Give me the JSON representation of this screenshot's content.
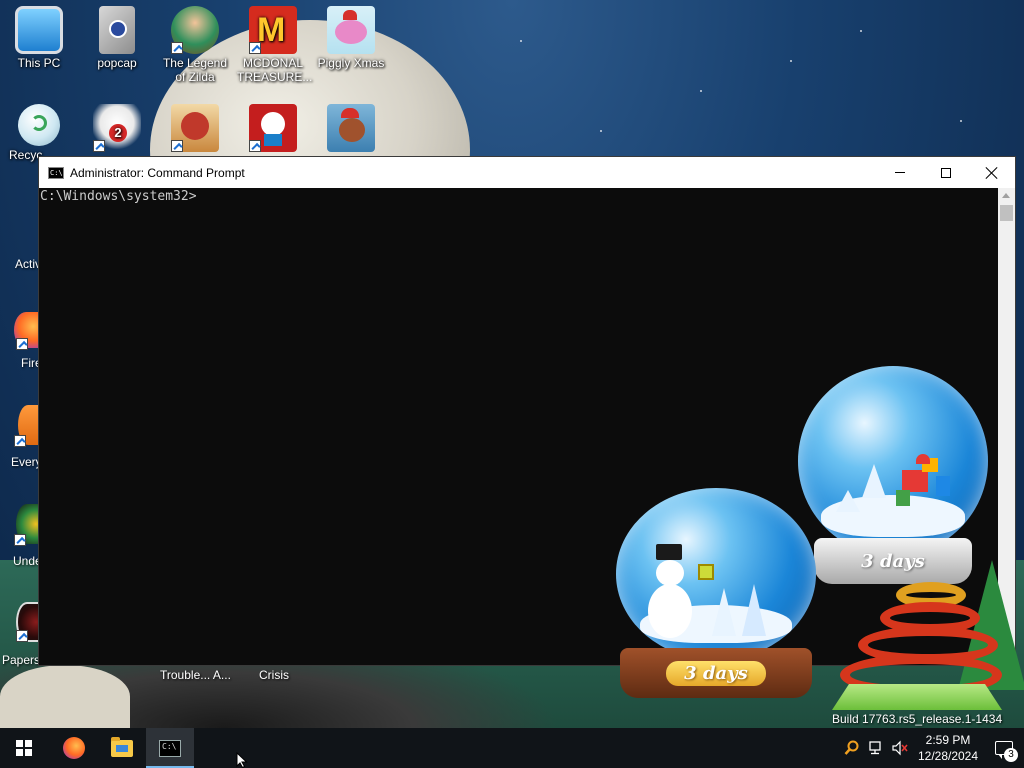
{
  "desktop": {
    "icons": [
      {
        "label": "This PC"
      },
      {
        "label": "popcap"
      },
      {
        "label": "The Legend of Zilda"
      },
      {
        "label": "MCDONAL TREASURE..."
      },
      {
        "label": "Piggly Xmas"
      },
      {
        "label": "Recyc"
      },
      {
        "label": ""
      },
      {
        "label": ""
      },
      {
        "label": ""
      },
      {
        "label": ""
      }
    ],
    "left_partial_labels": [
      "Activ",
      "Fire",
      "Every",
      "Unde",
      "Papers"
    ],
    "bottom_labels": [
      "Trouble... A...",
      "Crisis"
    ]
  },
  "cmd": {
    "title": "Administrator: Command Prompt",
    "prompt": "C:\\Windows\\system32>",
    "icon_name": "cmd-icon"
  },
  "gadget": {
    "globe_left_label": "3 days",
    "globe_right_label": "3 days"
  },
  "watermark": {
    "build": "Build 17763.rs5_release.1-1434"
  },
  "taskbar": {
    "time": "2:59 PM",
    "date": "12/28/2024",
    "notification_count": "3",
    "pinned": [
      "start-button",
      "firefox-icon",
      "file-explorer-icon",
      "command-prompt-icon"
    ]
  },
  "colors": {
    "taskbar": "#101418",
    "cmd_bg": "#0c0c0c",
    "cmd_text": "#cccccc",
    "accent": "#76b9ed"
  }
}
